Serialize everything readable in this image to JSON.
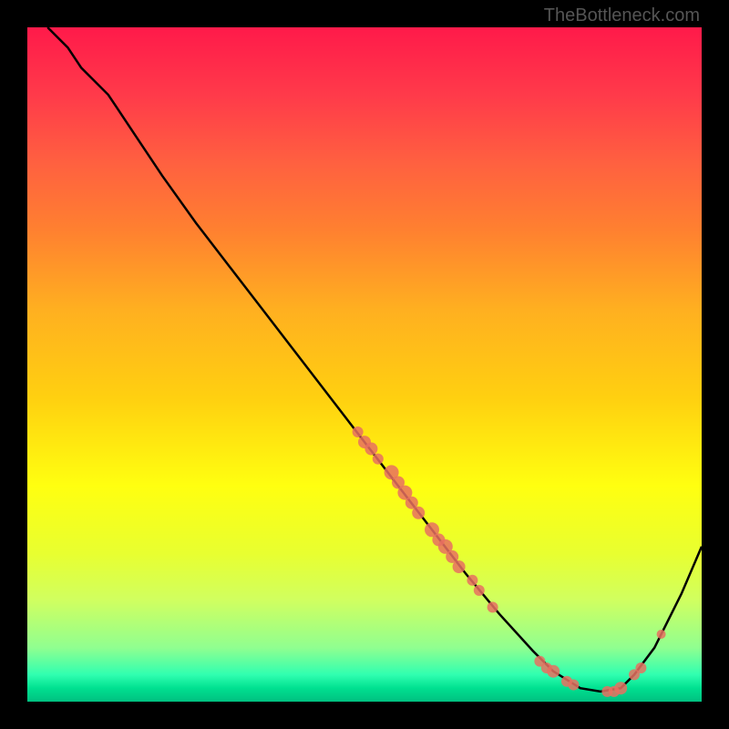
{
  "watermark": "TheBottleneck.com",
  "chart_data": {
    "type": "line",
    "title": "",
    "xlabel": "",
    "ylabel": "",
    "xlim": [
      0,
      100
    ],
    "ylim": [
      0,
      100
    ],
    "curve": {
      "name": "bottleneck-curve",
      "x": [
        3,
        6,
        8,
        12,
        16,
        20,
        25,
        30,
        35,
        40,
        45,
        50,
        55,
        60,
        65,
        70,
        75,
        78,
        82,
        85,
        88,
        90,
        93,
        97,
        100
      ],
      "y": [
        100,
        97,
        94,
        90,
        84,
        78,
        71,
        64.5,
        58,
        51.5,
        45,
        38.5,
        32,
        25.5,
        19,
        13,
        7.5,
        4.5,
        2,
        1.5,
        2,
        4,
        8,
        16,
        23
      ]
    },
    "markers": {
      "name": "data-points",
      "color": "#e87060",
      "points": [
        {
          "x": 49,
          "y": 40,
          "r": 6
        },
        {
          "x": 50,
          "y": 38.5,
          "r": 7
        },
        {
          "x": 51,
          "y": 37.5,
          "r": 7
        },
        {
          "x": 52,
          "y": 36,
          "r": 6
        },
        {
          "x": 54,
          "y": 34,
          "r": 8
        },
        {
          "x": 55,
          "y": 32.5,
          "r": 7
        },
        {
          "x": 56,
          "y": 31,
          "r": 8
        },
        {
          "x": 57,
          "y": 29.5,
          "r": 7
        },
        {
          "x": 58,
          "y": 28,
          "r": 7
        },
        {
          "x": 60,
          "y": 25.5,
          "r": 8
        },
        {
          "x": 61,
          "y": 24,
          "r": 7
        },
        {
          "x": 62,
          "y": 23,
          "r": 8
        },
        {
          "x": 63,
          "y": 21.5,
          "r": 7
        },
        {
          "x": 64,
          "y": 20,
          "r": 7
        },
        {
          "x": 66,
          "y": 18,
          "r": 6
        },
        {
          "x": 67,
          "y": 16.5,
          "r": 6
        },
        {
          "x": 69,
          "y": 14,
          "r": 6
        },
        {
          "x": 76,
          "y": 6,
          "r": 6
        },
        {
          "x": 77,
          "y": 5,
          "r": 6
        },
        {
          "x": 78,
          "y": 4.5,
          "r": 7
        },
        {
          "x": 80,
          "y": 3,
          "r": 6
        },
        {
          "x": 81,
          "y": 2.5,
          "r": 6
        },
        {
          "x": 86,
          "y": 1.5,
          "r": 6
        },
        {
          "x": 87,
          "y": 1.5,
          "r": 6
        },
        {
          "x": 88,
          "y": 2,
          "r": 7
        },
        {
          "x": 90,
          "y": 4,
          "r": 6
        },
        {
          "x": 91,
          "y": 5,
          "r": 6
        },
        {
          "x": 94,
          "y": 10,
          "r": 5
        }
      ]
    }
  }
}
